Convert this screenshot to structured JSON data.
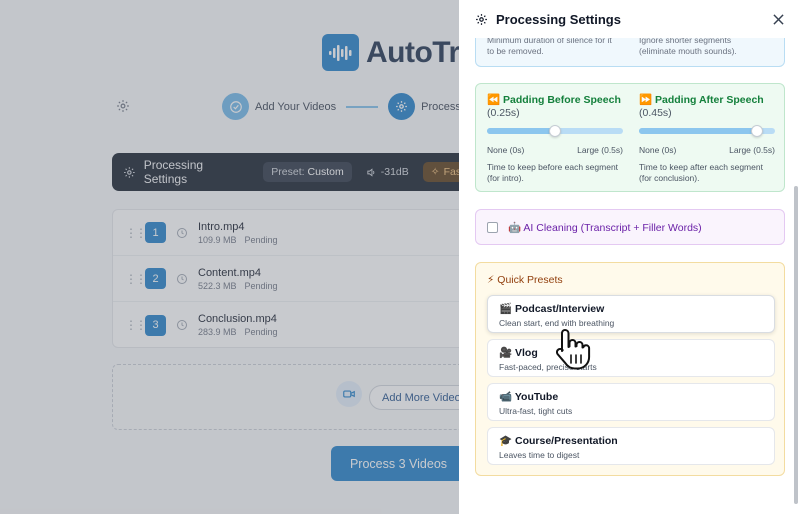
{
  "app": {
    "logo_text": "AutoTrim",
    "steps": [
      {
        "label": "Add Your Videos"
      },
      {
        "label": "Process"
      }
    ],
    "settings_bar": {
      "title": "Processing Settings",
      "preset_label": "Preset:",
      "preset_value": "Custom",
      "threshold": "-31dB",
      "speed": "Fast"
    },
    "videos": [
      {
        "number": "1",
        "name": "Intro.mp4",
        "size": "109.9 MB",
        "status": "Pending"
      },
      {
        "number": "2",
        "name": "Content.mp4",
        "size": "522.3 MB",
        "status": "Pending"
      },
      {
        "number": "3",
        "name": "Conclusion.mp4",
        "size": "283.9 MB",
        "status": "Pending"
      }
    ],
    "add_more_label": "Add More Videos",
    "process_button": "Process 3 Videos"
  },
  "panel": {
    "title": "Processing Settings",
    "top_card": {
      "left_text": "Minimum duration of silence for it to be removed.",
      "right_text": "Ignore shorter segments (eliminate mouth sounds)."
    },
    "padding": {
      "before": {
        "icon": "⏪",
        "title": "Padding Before Speech",
        "value": "(0.25s)",
        "level": 0.5,
        "min_label": "None (0s)",
        "max_label": "Large (0.5s)",
        "desc": "Time to keep before each segment (for intro)."
      },
      "after": {
        "icon": "⏩",
        "title": "Padding After Speech",
        "value": "(0.45s)",
        "level": 0.9,
        "min_label": "None (0s)",
        "max_label": "Large (0.5s)",
        "desc": "Time to keep after each segment (for conclusion)."
      }
    },
    "ai_cleaning": {
      "icon": "🤖",
      "label": "AI Cleaning (Transcript + Filler Words)",
      "checked": false
    },
    "presets": {
      "title": "⚡ Quick Presets",
      "items": [
        {
          "icon": "🎬",
          "name": "Podcast/Interview",
          "desc": "Clean start, end with breathing"
        },
        {
          "icon": "🎥",
          "name": "Vlog",
          "desc": "Fast-paced, precise starts"
        },
        {
          "icon": "📹",
          "name": "YouTube",
          "desc": "Ultra-fast, tight cuts"
        },
        {
          "icon": "🎓",
          "name": "Course/Presentation",
          "desc": "Leaves time to digest"
        }
      ]
    }
  }
}
